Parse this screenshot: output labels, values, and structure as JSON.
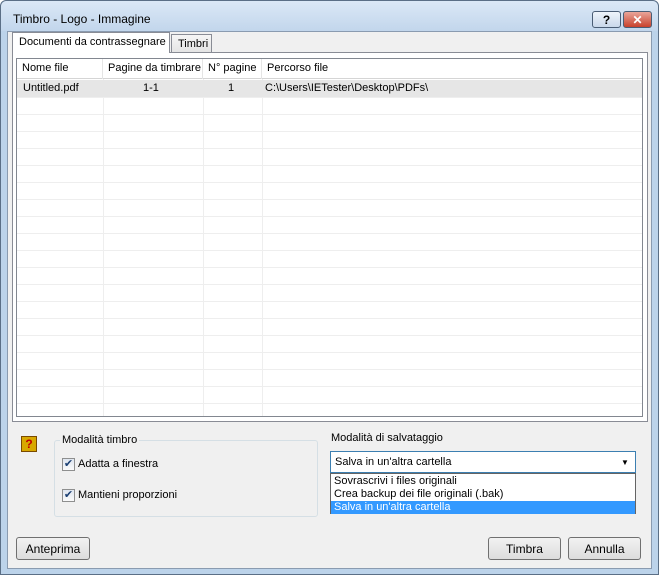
{
  "window": {
    "title": "Timbro - Logo - Immagine",
    "help_label": "?",
    "close_label": "✕"
  },
  "tabs": [
    {
      "label": "Documenti da contrassegnare",
      "active": true
    },
    {
      "label": "Timbri",
      "active": false
    }
  ],
  "grid": {
    "columns": [
      "Nome file",
      "Pagine da timbrare",
      "N° pagine",
      "Percorso file"
    ],
    "rows": [
      {
        "nome_file": "Untitled.pdf",
        "pagine_da_timbrare": "1-1",
        "n_pagine": "1",
        "percorso_file": "C:\\Users\\IETester\\Desktop\\PDFs\\"
      }
    ]
  },
  "help_icon": {
    "glyph": "?",
    "icon": "help-icon"
  },
  "modalita_timbro": {
    "label": "Modalità timbro",
    "options": [
      {
        "label": "Adatta a finestra",
        "checked": true
      },
      {
        "label": "Mantieni proporzioni",
        "checked": true
      }
    ]
  },
  "salvataggio": {
    "label": "Modalità di salvataggio",
    "selected": "Salva in un'altra cartella",
    "options": [
      "Sovrascrivi i files originali",
      "Crea backup dei file originali (.bak)",
      "Salva in un'altra cartella"
    ]
  },
  "buttons": {
    "preview": "Anteprima",
    "stamp": "Timbra",
    "cancel": "Annulla"
  },
  "colors": {
    "selection": "#3399ff",
    "titlebar": "#c2d6ec",
    "close": "#c8412c"
  }
}
